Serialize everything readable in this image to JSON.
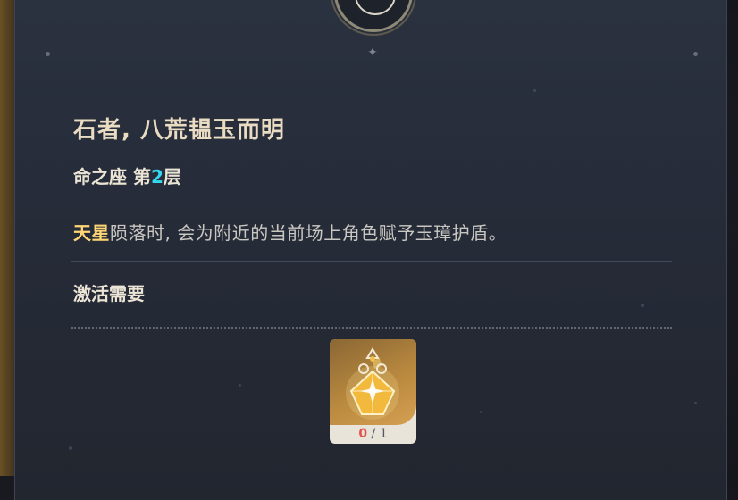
{
  "constellation": {
    "title": "石者, 八荒韫玉而明",
    "level_prefix": "命之座 第",
    "level_number": "2",
    "level_suffix": "层",
    "description_keyword": "天星",
    "description_rest": "陨落时, 会为附近的当前场上角色赋予玉璋护盾。"
  },
  "requirement": {
    "title": "激活需要",
    "item": {
      "icon": "constellation-gem-icon",
      "have": "0",
      "separator": " / ",
      "need": "1"
    }
  },
  "colors": {
    "title": "#e9dcc2",
    "keyword": "#ffd675",
    "level_number": "#35d6f0",
    "count_deficit": "#e0524b"
  }
}
